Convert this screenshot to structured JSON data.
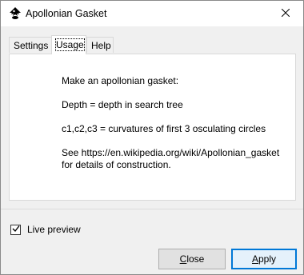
{
  "window": {
    "title": "Apollonian Gasket"
  },
  "tabs": [
    {
      "label": "Settings",
      "active": false
    },
    {
      "label": "Usage",
      "active": true
    },
    {
      "label": "Help",
      "active": false
    }
  ],
  "usage": {
    "lines": [
      "Make an apollonian gasket:",
      "Depth = depth in search tree",
      "c1,c2,c3 = curvatures of first 3 osculating circles",
      "See https://en.wikipedia.org/wiki/Apollonian_gasket\nfor details of construction."
    ]
  },
  "live_preview": {
    "label": "Live preview",
    "checked": true
  },
  "buttons": {
    "close_mnemonic": "C",
    "close_rest": "lose",
    "apply_mnemonic": "A",
    "apply_rest": "pply"
  },
  "icons": {
    "app": "inkscape-icon",
    "close": "close-icon",
    "check": "checkmark-icon"
  },
  "colors": {
    "accent": "#0078d7",
    "panel_bg": "#ffffff",
    "window_bg": "#f0f0f0"
  }
}
